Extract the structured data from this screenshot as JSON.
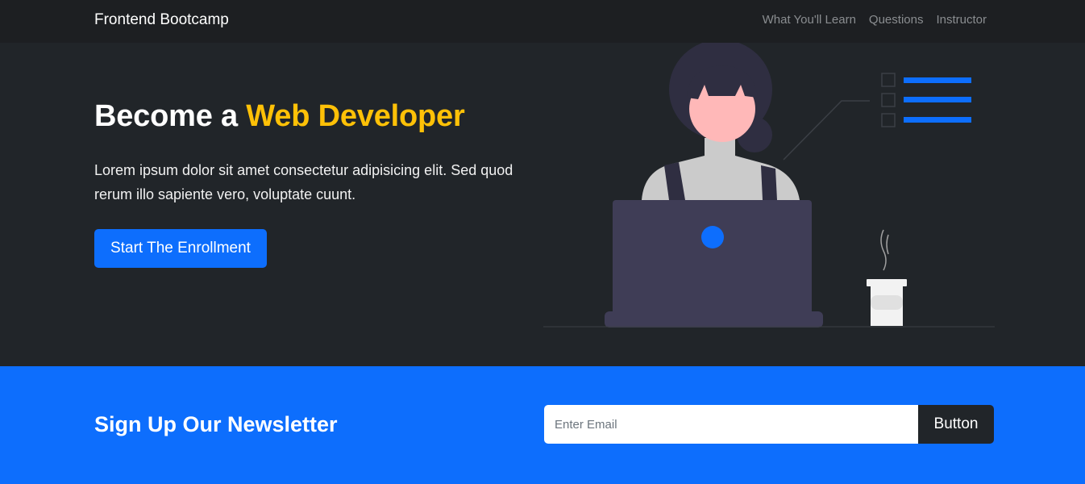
{
  "navbar": {
    "brand": "Frontend Bootcamp",
    "links": [
      {
        "label": "What You'll Learn"
      },
      {
        "label": "Questions"
      },
      {
        "label": "Instructor"
      }
    ]
  },
  "hero": {
    "title_prefix": "Become a ",
    "title_accent": "Web Developer",
    "description": "Lorem ipsum dolor sit amet consectetur adipisicing elit. Sed quod rerum illo sapiente vero, voluptate cuunt.",
    "cta_label": "Start The Enrollment",
    "illustration": "person-at-laptop-illustration"
  },
  "newsletter": {
    "title": "Sign Up Our Newsletter",
    "email_placeholder": "Enter Email",
    "email_value": "",
    "button_label": "Button"
  },
  "colors": {
    "dark": "#212529",
    "navbar": "#1d1f22",
    "primary": "#0d6efd",
    "accent": "#ffc107"
  }
}
